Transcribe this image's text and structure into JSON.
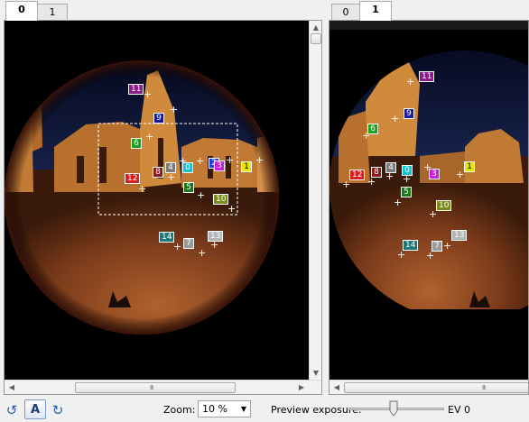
{
  "left_tabs": [
    "0",
    "1"
  ],
  "right_tabs": [
    "0",
    "1"
  ],
  "left_active_tab": "0",
  "right_active_tab": "1",
  "left_points": [
    {
      "label": "11",
      "color": "#8b1a8b"
    },
    {
      "label": "9",
      "color": "#1a1a9c"
    },
    {
      "label": "6",
      "color": "#1ca21c"
    },
    {
      "label": "4",
      "color": "#7a7a7a"
    },
    {
      "label": "0",
      "color": "#17c2d0"
    },
    {
      "label": "2",
      "color": "#1f3fd8"
    },
    {
      "label": "3",
      "color": "#d01fd8"
    },
    {
      "label": "1",
      "color": "#e6e600"
    },
    {
      "label": "8",
      "color": "#8b1a1a"
    },
    {
      "label": "12",
      "color": "#d81f1f"
    },
    {
      "label": "5",
      "color": "#1a7a1a"
    },
    {
      "label": "10",
      "color": "#7a8b1a"
    },
    {
      "label": "14",
      "color": "#1a7a7a"
    },
    {
      "label": "7",
      "color": "#9a9a9a"
    },
    {
      "label": "13",
      "color": "#b4b4b4"
    }
  ],
  "right_points": [
    {
      "label": "11",
      "color": "#8b1a8b"
    },
    {
      "label": "9",
      "color": "#1a1a9c"
    },
    {
      "label": "6",
      "color": "#1ca21c"
    },
    {
      "label": "12",
      "color": "#d81f1f"
    },
    {
      "label": "8",
      "color": "#8b1a1a"
    },
    {
      "label": "4",
      "color": "#7a7a7a"
    },
    {
      "label": "0",
      "color": "#17c2d0"
    },
    {
      "label": "3",
      "color": "#d01fd8"
    },
    {
      "label": "1",
      "color": "#e6e600"
    },
    {
      "label": "5",
      "color": "#1a7a1a"
    },
    {
      "label": "10",
      "color": "#7a8b1a"
    },
    {
      "label": "14",
      "color": "#1a7a7a"
    },
    {
      "label": "7",
      "color": "#9a9a9a"
    },
    {
      "label": "13",
      "color": "#b4b4b4"
    }
  ],
  "toolbar": {
    "auto_label": "A",
    "zoom_label": "Zoom:",
    "zoom_value": "10 %",
    "exposure_label": "Preview exposure:",
    "ev_value": "EV 0",
    "ev_level": 0
  },
  "scroll_grip": "III"
}
